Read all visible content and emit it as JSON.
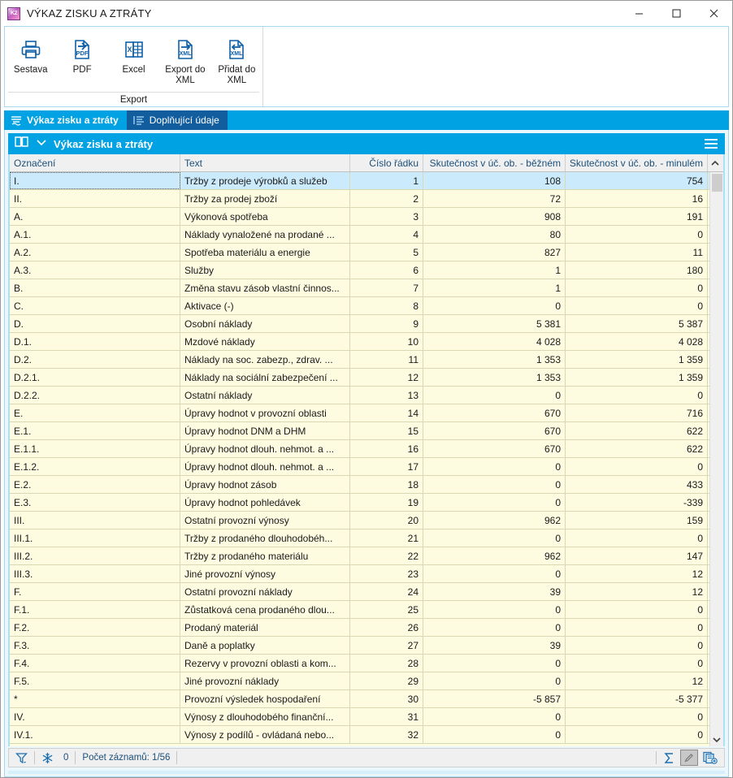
{
  "window": {
    "title": "VÝKAZ ZISKU A ZTRÁTY",
    "app_icon": "k2-app-icon",
    "minimize_label": "Minimalizovat",
    "maximize_label": "Maximalizovat",
    "close_label": "Zavřít"
  },
  "ribbon": {
    "group_title": "Export",
    "buttons": [
      {
        "label": "Sestava",
        "icon": "printer-icon"
      },
      {
        "label": "PDF",
        "icon": "pdf-export-icon"
      },
      {
        "label": "Excel",
        "icon": "excel-icon"
      },
      {
        "label": "Export do XML",
        "icon": "xml-export-icon"
      },
      {
        "label": "Přidat do XML",
        "icon": "xml-import-icon"
      }
    ]
  },
  "tabs": [
    {
      "label": "Výkaz zisku a ztráty",
      "active": true,
      "icon": "report-lines-icon"
    },
    {
      "label": "Doplňující údaje",
      "active": false,
      "icon": "list-detail-icon"
    }
  ],
  "section": {
    "title": "Výkaz zisku a ztráty",
    "book_icon": "book-icon",
    "chevron_icon": "chevron-down-icon",
    "menu_icon": "hamburger-menu-icon"
  },
  "grid": {
    "columns": [
      {
        "key": "oznaceni",
        "label": "Označení",
        "align": "left"
      },
      {
        "key": "text",
        "label": "Text",
        "align": "left"
      },
      {
        "key": "cislo",
        "label": "Číslo řádku",
        "align": "right"
      },
      {
        "key": "bezne",
        "label": "Skutečnost v úč. ob. - běžném",
        "align": "right"
      },
      {
        "key": "minule",
        "label": "Skutečnost v úč. ob. - minulém",
        "align": "right"
      }
    ],
    "rows": [
      {
        "oznaceni": "I.",
        "text": "Tržby z prodeje výrobků a služeb",
        "cislo": "1",
        "bezne": "108",
        "minule": "754",
        "selected": true
      },
      {
        "oznaceni": "II.",
        "text": "Tržby za prodej zboží",
        "cislo": "2",
        "bezne": "72",
        "minule": "16"
      },
      {
        "oznaceni": "A.",
        "text": "Výkonová spotřeba",
        "cislo": "3",
        "bezne": "908",
        "minule": "191"
      },
      {
        "oznaceni": "A.1.",
        "text": "Náklady vynaložené na prodané ...",
        "cislo": "4",
        "bezne": "80",
        "minule": "0"
      },
      {
        "oznaceni": "A.2.",
        "text": "Spotřeba materiálu a energie",
        "cislo": "5",
        "bezne": "827",
        "minule": "11"
      },
      {
        "oznaceni": "A.3.",
        "text": "Služby",
        "cislo": "6",
        "bezne": "1",
        "minule": "180"
      },
      {
        "oznaceni": "B.",
        "text": "Změna stavu zásob vlastní činnos...",
        "cislo": "7",
        "bezne": "1",
        "minule": "0"
      },
      {
        "oznaceni": "C.",
        "text": "Aktivace (-)",
        "cislo": "8",
        "bezne": "0",
        "minule": "0"
      },
      {
        "oznaceni": "D.",
        "text": "Osobní náklady",
        "cislo": "9",
        "bezne": "5 381",
        "minule": "5 387"
      },
      {
        "oznaceni": "D.1.",
        "text": "Mzdové náklady",
        "cislo": "10",
        "bezne": "4 028",
        "minule": "4 028"
      },
      {
        "oznaceni": "D.2.",
        "text": "Náklady na soc. zabezp., zdrav. ...",
        "cislo": "11",
        "bezne": "1 353",
        "minule": "1 359"
      },
      {
        "oznaceni": "D.2.1.",
        "text": "Náklady na sociální zabezpečení ...",
        "cislo": "12",
        "bezne": "1 353",
        "minule": "1 359"
      },
      {
        "oznaceni": "D.2.2.",
        "text": "Ostatní náklady",
        "cislo": "13",
        "bezne": "0",
        "minule": "0"
      },
      {
        "oznaceni": "E.",
        "text": "Úpravy hodnot v provozní oblasti",
        "cislo": "14",
        "bezne": "670",
        "minule": "716"
      },
      {
        "oznaceni": "E.1.",
        "text": "Úpravy hodnot DNM a DHM",
        "cislo": "15",
        "bezne": "670",
        "minule": "622"
      },
      {
        "oznaceni": "E.1.1.",
        "text": "Úpravy hodnot dlouh. nehmot. a ...",
        "cislo": "16",
        "bezne": "670",
        "minule": "622"
      },
      {
        "oznaceni": "E.1.2.",
        "text": "Úpravy hodnot dlouh. nehmot. a ...",
        "cislo": "17",
        "bezne": "0",
        "minule": "0"
      },
      {
        "oznaceni": "E.2.",
        "text": "Úpravy hodnot zásob",
        "cislo": "18",
        "bezne": "0",
        "minule": "433"
      },
      {
        "oznaceni": "E.3.",
        "text": "Úpravy hodnot pohledávek",
        "cislo": "19",
        "bezne": "0",
        "minule": "-339"
      },
      {
        "oznaceni": "III.",
        "text": "Ostatní provozní výnosy",
        "cislo": "20",
        "bezne": "962",
        "minule": "159"
      },
      {
        "oznaceni": "III.1.",
        "text": "Tržby z prodaného dlouhodobéh...",
        "cislo": "21",
        "bezne": "0",
        "minule": "0"
      },
      {
        "oznaceni": "III.2.",
        "text": "Tržby z prodaného materiálu",
        "cislo": "22",
        "bezne": "962",
        "minule": "147"
      },
      {
        "oznaceni": "III.3.",
        "text": "Jiné provozní výnosy",
        "cislo": "23",
        "bezne": "0",
        "minule": "12"
      },
      {
        "oznaceni": "F.",
        "text": "Ostatní provozní náklady",
        "cislo": "24",
        "bezne": "39",
        "minule": "12"
      },
      {
        "oznaceni": "F.1.",
        "text": "Zůstatková cena prodaného dlou...",
        "cislo": "25",
        "bezne": "0",
        "minule": "0"
      },
      {
        "oznaceni": "F.2.",
        "text": "Prodaný materiál",
        "cislo": "26",
        "bezne": "0",
        "minule": "0"
      },
      {
        "oznaceni": "F.3.",
        "text": "Daně a poplatky",
        "cislo": "27",
        "bezne": "39",
        "minule": "0"
      },
      {
        "oznaceni": "F.4.",
        "text": "Rezervy v provozní oblasti a kom...",
        "cislo": "28",
        "bezne": "0",
        "minule": "0"
      },
      {
        "oznaceni": "F.5.",
        "text": "Jiné provozní náklady",
        "cislo": "29",
        "bezne": "0",
        "minule": "12"
      },
      {
        "oznaceni": "*",
        "text": "Provozní výsledek hospodaření",
        "cislo": "30",
        "bezne": "-5 857",
        "minule": "-5 377"
      },
      {
        "oznaceni": "IV.",
        "text": "Výnosy z dlouhodobého finanční...",
        "cislo": "31",
        "bezne": "0",
        "minule": "0"
      },
      {
        "oznaceni": "IV.1.",
        "text": "Výnosy z podílů - ovládaná nebo...",
        "cislo": "32",
        "bezne": "0",
        "minule": "0"
      }
    ]
  },
  "statusbar": {
    "filter_icon": "filter-icon",
    "freeze_icon": "snowflake-icon",
    "freeze_count": "0",
    "record_count": "Počet záznamů: 1/56",
    "sum_icon": "sigma-sum-icon",
    "edit_icon": "pencil-edit-icon",
    "add_record_icon": "add-record-icon"
  },
  "colors": {
    "accent_cyan": "#00a2e3",
    "tab_inactive": "#125d9e",
    "row_default": "#fdfbe0",
    "row_selected": "#cbeafb",
    "header_text": "#1b4f7a"
  }
}
